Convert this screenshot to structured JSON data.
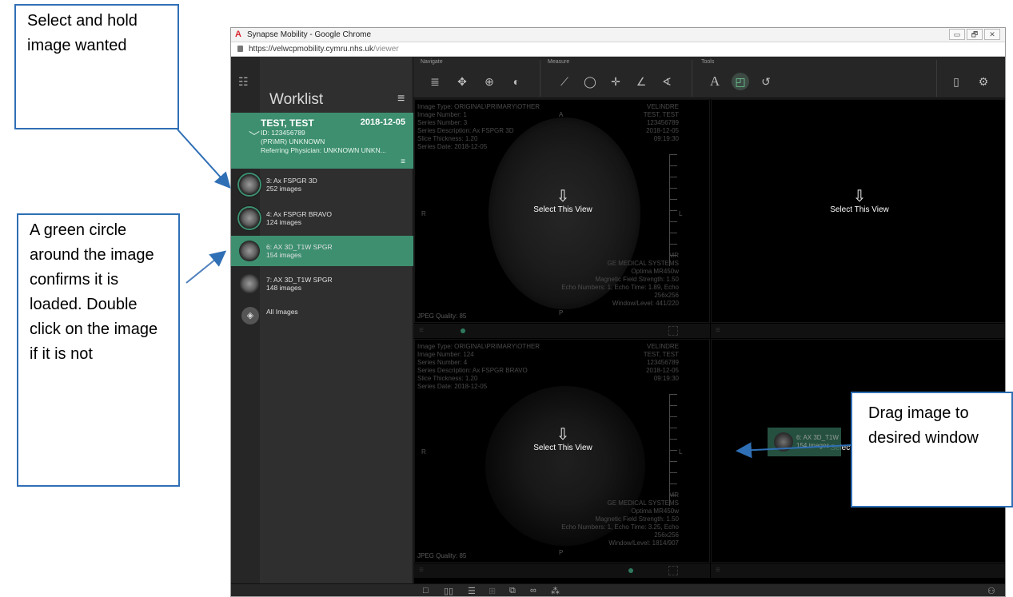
{
  "browser": {
    "window_title": "Synapse Mobility - Google Chrome",
    "url_host": "https://velwcpmobility.cymru.nhs.uk",
    "url_path": "/viewer",
    "win_buttons": [
      "▭",
      "🗗",
      "✕"
    ]
  },
  "toolbar": {
    "navigate_label": "Navigate",
    "measure_label": "Measure",
    "tools_label": "Tools"
  },
  "worklist": {
    "title": "Worklist",
    "patient": {
      "name": "TEST, TEST",
      "date": "2018-12-05",
      "id": "ID: 123456789",
      "modality": "(PR\\MR) UNKNOWN",
      "physician": "Referring Physician: UNKNOWN UNKN..."
    },
    "series": [
      {
        "name": "3: Ax FSPGR 3D",
        "count": "252 images"
      },
      {
        "name": "4: Ax FSPGR BRAVO",
        "count": "124 images"
      },
      {
        "name": "6: AX 3D_T1W SPGR",
        "count": "154 images"
      },
      {
        "name": "7: AX 3D_T1W SPGR",
        "count": "148 images"
      }
    ],
    "all_images": "All Images"
  },
  "viewports": {
    "select_label": "Select This View",
    "vp1": {
      "left": [
        "Image Type: ORIGINAL\\PRIMARY\\OTHER",
        "Image Number: 1",
        "Series Number: 3",
        "Series Description: Ax FSPGR 3D",
        "Slice Thickness: 1.20",
        "Series Date: 2018-12-05"
      ],
      "right": [
        "VELINDRE",
        "TEST, TEST",
        "123456789",
        "2018-12-05",
        "09:19:30"
      ],
      "bottom_right": [
        "MR",
        "GE MEDICAL SYSTEMS",
        "Optima MR450w",
        "Magnetic Field Strength: 1.50",
        "Echo Numbers: 1, Echo Time: 1.89, Echo",
        "256x256",
        "Window/Level: 441/220"
      ],
      "jpeg": "JPEG Quality: 85",
      "orient": {
        "top": "A",
        "left": "R",
        "right": "L",
        "bottom": "P"
      }
    },
    "vp3": {
      "left": [
        "Image Type: ORIGINAL\\PRIMARY\\OTHER",
        "Image Number: 124",
        "Series Number: 4",
        "Series Description: Ax FSPGR BRAVO",
        "Slice Thickness: 1.20",
        "Series Date: 2018-12-05"
      ],
      "right": [
        "VELINDRE",
        "TEST, TEST",
        "123456789",
        "2018-12-05",
        "09:19:30"
      ],
      "bottom_right": [
        "MR",
        "GE MEDICAL SYSTEMS",
        "Optima MR450w",
        "Magnetic Field Strength: 1.50",
        "Echo Numbers: 1, Echo Time: 3.25, Echo",
        "256x256",
        "Window/Level: 1814/907"
      ],
      "jpeg": "JPEG Quality: 85",
      "orient": {
        "left": "R",
        "right": "L",
        "bottom": "P"
      }
    },
    "ghost": {
      "name": "6: AX 3D_T1W",
      "count": "154 images"
    }
  },
  "annotations": {
    "select_hold": "Select and hold image wanted",
    "green_circle": "A green circle around the image confirms it is loaded. Double click on the image if it is not",
    "drag": "Drag image to desired window"
  },
  "colors": {
    "accent_green": "#3d8f70",
    "callout_border": "#2f6fb5"
  }
}
